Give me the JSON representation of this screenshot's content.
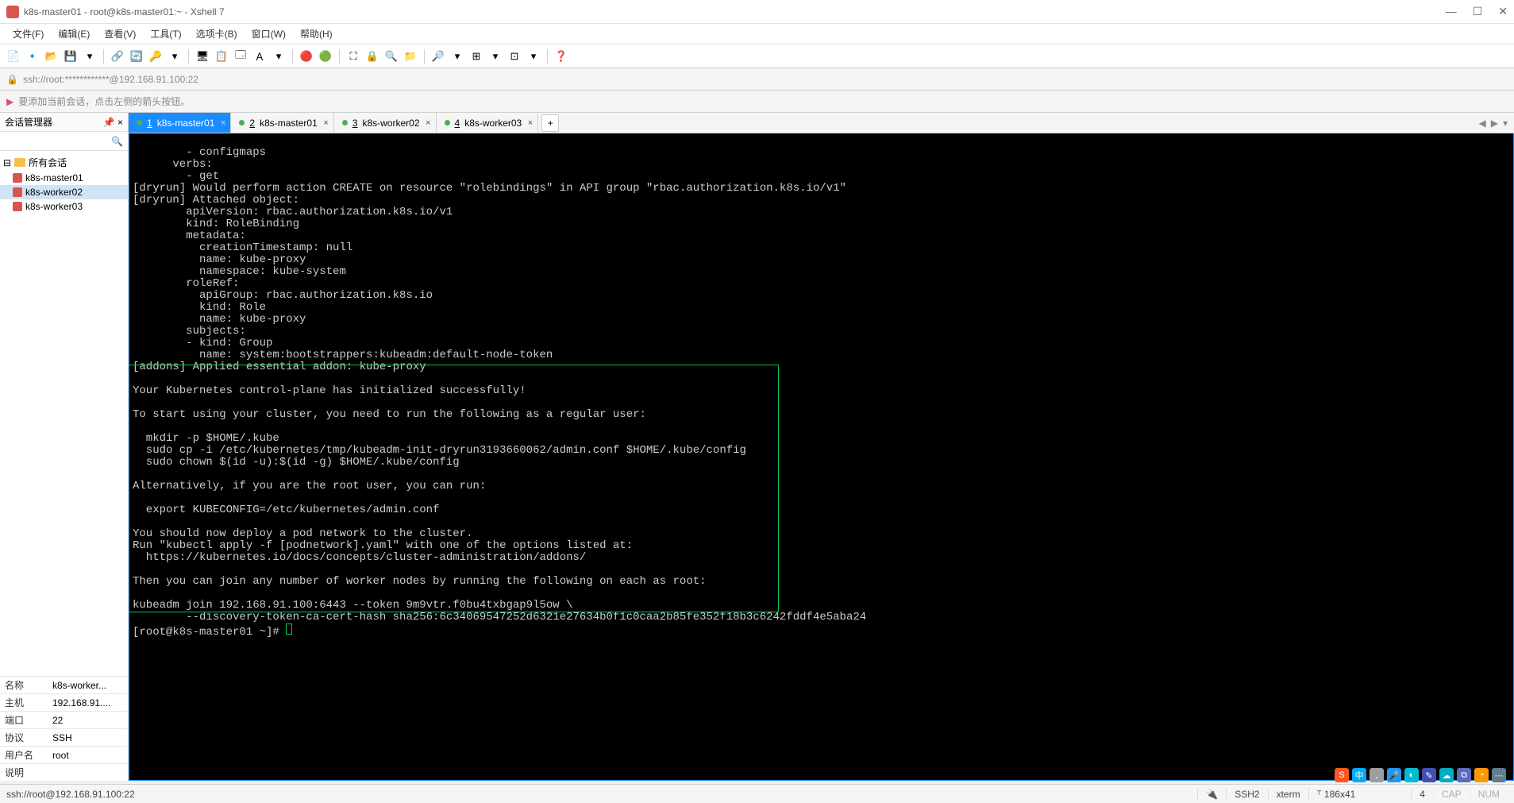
{
  "window": {
    "title": "k8s-master01 - root@k8s-master01:~ - Xshell 7",
    "controls": {
      "min": "—",
      "max": "☐",
      "close": "✕"
    }
  },
  "menu": {
    "file": "文件(F)",
    "edit": "编辑(E)",
    "view": "查看(V)",
    "tools": "工具(T)",
    "tab": "选项卡(B)",
    "window": "窗口(W)",
    "help": "帮助(H)"
  },
  "address": {
    "lock": "🔒",
    "text": "ssh://root:************@192.168.91.100:22"
  },
  "infobar": {
    "flag": "▶",
    "text": "要添加当前会话，点击左侧的箭头按钮。"
  },
  "sidebar": {
    "title": "会话管理器",
    "pin": "📌",
    "close": "×",
    "searchIcon": "🔍",
    "root": {
      "expand": "⊟",
      "label": "所有会话"
    },
    "items": [
      {
        "label": "k8s-master01"
      },
      {
        "label": "k8s-worker02"
      },
      {
        "label": "k8s-worker03"
      }
    ],
    "props": {
      "nameLabel": "名称",
      "nameValue": "k8s-worker...",
      "hostLabel": "主机",
      "hostValue": "192.168.91....",
      "portLabel": "端口",
      "portValue": "22",
      "protoLabel": "协议",
      "protoValue": "SSH",
      "userLabel": "用户名",
      "userValue": "root",
      "descLabel": "说明",
      "descValue": ""
    }
  },
  "tabs": {
    "items": [
      {
        "num": "1",
        "label": "k8s-master01",
        "active": true
      },
      {
        "num": "2",
        "label": "k8s-master01",
        "active": false
      },
      {
        "num": "3",
        "label": "k8s-worker02",
        "active": false
      },
      {
        "num": "4",
        "label": "k8s-worker03",
        "active": false
      }
    ],
    "add": "+",
    "navLeft": "◀",
    "navRight": "▶",
    "menu": "▾"
  },
  "terminal": {
    "pre": "        - configmaps\n      verbs:\n        - get\n[dryrun] Would perform action CREATE on resource \"rolebindings\" in API group \"rbac.authorization.k8s.io/v1\"\n[dryrun] Attached object:\n        apiVersion: rbac.authorization.k8s.io/v1\n        kind: RoleBinding\n        metadata:\n          creationTimestamp: null\n          name: kube-proxy\n          namespace: kube-system\n        roleRef:\n          apiGroup: rbac.authorization.k8s.io\n          kind: Role\n          name: kube-proxy\n        subjects:\n        - kind: Group\n          name: system:bootstrappers:kubeadm:default-node-token\n[addons] Applied essential addon: kube-proxy\n",
    "boxed": "\nYour Kubernetes control-plane has initialized successfully!\n\nTo start using your cluster, you need to run the following as a regular user:\n\n  mkdir -p $HOME/.kube\n  sudo cp -i /etc/kubernetes/tmp/kubeadm-init-dryrun3193660062/admin.conf $HOME/.kube/config\n  sudo chown $(id -u):$(id -g) $HOME/.kube/config\n\nAlternatively, if you are the root user, you can run:\n\n  export KUBECONFIG=/etc/kubernetes/admin.conf\n\nYou should now deploy a pod network to the cluster.\nRun \"kubectl apply -f [podnetwork].yaml\" with one of the options listed at:\n  https://kubernetes.io/docs/concepts/cluster-administration/addons/\n\nThen you can join any number of worker nodes by running the following on each as root:\n\nkubeadm join 192.168.91.100:6443 --token 9m9vtr.f0bu4txbgap9l5ow \\\n        --discovery-token-ca-cert-hash sha256:6c34069547252d6321e27634b0f1c0caa2b85fe352f18b3c6242fddf4e5aba24",
    "prompt": "[root@k8s-master01 ~]# "
  },
  "status": {
    "left": "ssh://root@192.168.91.100:22",
    "ssh": "SSH2",
    "term": "xterm",
    "size": "186x41",
    "sizeIcon": "⸆",
    "sessions": "4",
    "tray": "🔌",
    "caps": "CAP",
    "num": "NUM"
  },
  "watermark": "",
  "toolbar_icons": [
    "📄",
    "🔹",
    "📂",
    "💾",
    "▾",
    "",
    "🔗",
    "🔄",
    "🔑",
    "▾",
    "",
    "🖥",
    "📋",
    "🗔",
    "Ａ",
    "▾",
    "",
    "🔴",
    "🟢",
    "",
    "⛶",
    "🔒",
    "🔍",
    "📁",
    "",
    "🔎",
    "▾",
    "⊞",
    "▾",
    "⊡",
    "▾",
    "",
    "❓"
  ],
  "tray_icons": [
    {
      "bg": "#ff5722",
      "t": "S"
    },
    {
      "bg": "#03a9f4",
      "t": "中"
    },
    {
      "bg": "#9e9e9e",
      "t": "᎐"
    },
    {
      "bg": "#2196f3",
      "t": "🎤"
    },
    {
      "bg": "#00bcd4",
      "t": "◐"
    },
    {
      "bg": "#3f51b5",
      "t": "✎"
    },
    {
      "bg": "#00acc1",
      "t": "☁"
    },
    {
      "bg": "#5c6bc0",
      "t": "⧉"
    },
    {
      "bg": "#ff9800",
      "t": "◔"
    },
    {
      "bg": "#607d8b",
      "t": "⋯"
    }
  ]
}
